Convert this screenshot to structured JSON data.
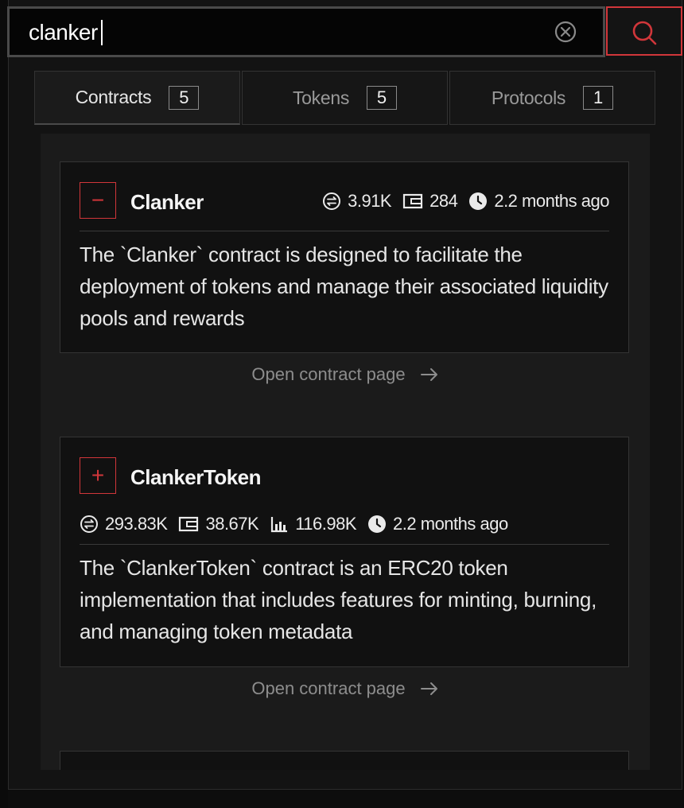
{
  "search": {
    "query": "clanker",
    "placeholder": ""
  },
  "tabs": [
    {
      "label": "Contracts",
      "count": "5",
      "active": true
    },
    {
      "label": "Tokens",
      "count": "5",
      "active": false
    },
    {
      "label": "Protocols",
      "count": "1",
      "active": false
    }
  ],
  "results": [
    {
      "title": "Clanker",
      "expanded": true,
      "toggle_symbol": "−",
      "stats": {
        "transactions": "3.91K",
        "wallets": "284",
        "updated": "2.2 months ago"
      },
      "description": "The `Clanker` contract is designed to facilitate the deployment of tokens and manage their associated liquidity pools and rewards",
      "link_label": "Open contract page"
    },
    {
      "title": "ClankerToken",
      "expanded": false,
      "toggle_symbol": "+",
      "stats": {
        "transactions": "293.83K",
        "wallets": "38.67K",
        "volume": "116.98K",
        "updated": "2.2 months ago"
      },
      "description": "The `ClankerToken` contract is an ERC20 token implementation that includes features for minting, burning, and managing token metadata",
      "link_label": "Open contract page"
    }
  ],
  "colors": {
    "accent": "#d1363a",
    "background": "#131313",
    "card": "#111111"
  },
  "icons": {
    "clear": "circle-x-icon",
    "search": "magnifier-icon",
    "transactions": "transfer-icon",
    "wallets": "wallet-icon",
    "volume": "chart-icon",
    "updated": "clock-icon",
    "link": "arrow-right-icon"
  }
}
